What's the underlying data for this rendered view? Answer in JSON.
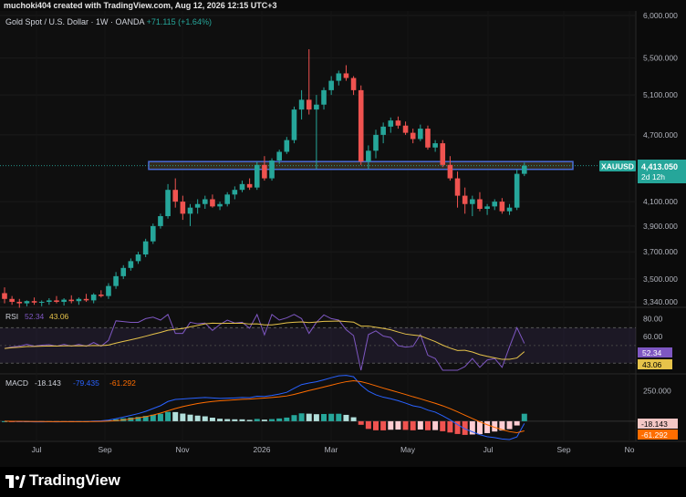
{
  "header": {
    "created_by": "muchoki404 created with TradingView.com, Aug 12, 2026 12:15 UTC+3"
  },
  "legend": {
    "symbol": "Gold Spot / U.S. Dollar · 1W · OANDA",
    "change": "+71.115 (+1.64%)"
  },
  "price_badge": {
    "ticker": "XAUUSD",
    "price": "4,413.050",
    "countdown": "2d 12h"
  },
  "rsi_legend": {
    "label": "RSI",
    "rsi": "52.34",
    "ma": "43.06"
  },
  "macd_legend": {
    "label": "MACD",
    "macd": "-18.143",
    "signal": "-79.435",
    "hist": "-61.292"
  },
  "footer": {
    "brand": "TradingView"
  },
  "colors": {
    "up": "#26a69a",
    "down": "#ef5350",
    "rsi": "#7e57c2",
    "rsi_ma": "#e6c34a",
    "macd": "#2962ff",
    "signal": "#ff6d00",
    "zone": "#4a6bd6"
  },
  "chart_data": [
    {
      "type": "candlestick",
      "title": "Gold Spot / U.S. Dollar · 1W · OANDA",
      "x_tick_labels": [
        "Jul",
        "Sep",
        "Nov",
        "2026",
        "Mar",
        "May",
        "Jul",
        "Sep",
        "No"
      ],
      "y_tick_labels": [
        "6,000.000",
        "5,500.000",
        "5,100.000",
        "4,700.000",
        "4,100.000",
        "3,900.000",
        "3,700.000",
        "3,500.000",
        "3,340.000"
      ],
      "y_scale": "log",
      "ylim": [
        3340,
        6000
      ],
      "last_price": 4413.05,
      "zone": [
        4380,
        4450
      ],
      "candles": [
        [
          3400,
          3440,
          3330,
          3360
        ],
        [
          3360,
          3380,
          3320,
          3340
        ],
        [
          3340,
          3360,
          3300,
          3330
        ],
        [
          3330,
          3350,
          3310,
          3345
        ],
        [
          3345,
          3370,
          3320,
          3335
        ],
        [
          3335,
          3350,
          3310,
          3340
        ],
        [
          3340,
          3365,
          3320,
          3350
        ],
        [
          3350,
          3380,
          3330,
          3340
        ],
        [
          3340,
          3365,
          3315,
          3355
        ],
        [
          3355,
          3385,
          3330,
          3345
        ],
        [
          3345,
          3370,
          3320,
          3360
        ],
        [
          3360,
          3395,
          3340,
          3350
        ],
        [
          3350,
          3400,
          3330,
          3390
        ],
        [
          3390,
          3420,
          3370,
          3380
        ],
        [
          3380,
          3470,
          3360,
          3450
        ],
        [
          3450,
          3550,
          3430,
          3520
        ],
        [
          3520,
          3600,
          3500,
          3580
        ],
        [
          3580,
          3650,
          3560,
          3630
        ],
        [
          3630,
          3700,
          3610,
          3680
        ],
        [
          3680,
          3800,
          3660,
          3780
        ],
        [
          3780,
          3920,
          3760,
          3900
        ],
        [
          3900,
          4000,
          3880,
          3980
        ],
        [
          3980,
          4250,
          3960,
          4200
        ],
        [
          4200,
          4300,
          4050,
          4100
        ],
        [
          4100,
          4150,
          3950,
          4000
        ],
        [
          4000,
          4080,
          3900,
          4050
        ],
        [
          4050,
          4120,
          4000,
          4080
        ],
        [
          4080,
          4150,
          4040,
          4120
        ],
        [
          4120,
          4160,
          4050,
          4060
        ],
        [
          4060,
          4100,
          4030,
          4080
        ],
        [
          4080,
          4180,
          4060,
          4160
        ],
        [
          4160,
          4230,
          4120,
          4200
        ],
        [
          4200,
          4280,
          4180,
          4250
        ],
        [
          4250,
          4300,
          4200,
          4220
        ],
        [
          4220,
          4450,
          4200,
          4420
        ],
        [
          4420,
          4500,
          4280,
          4300
        ],
        [
          4300,
          4480,
          4280,
          4460
        ],
        [
          4460,
          4560,
          4430,
          4540
        ],
        [
          4540,
          4680,
          4520,
          4650
        ],
        [
          4650,
          4980,
          4620,
          4950
        ],
        [
          4950,
          5150,
          4850,
          5050
        ],
        [
          5050,
          5600,
          4900,
          4950
        ],
        [
          4950,
          5100,
          4380,
          5000
        ],
        [
          5000,
          5180,
          4950,
          5150
        ],
        [
          5150,
          5300,
          5100,
          5250
        ],
        [
          5250,
          5360,
          5200,
          5330
        ],
        [
          5330,
          5420,
          5250,
          5280
        ],
        [
          5280,
          5300,
          5100,
          5150
        ],
        [
          5150,
          5200,
          4420,
          4450
        ],
        [
          4450,
          4600,
          4380,
          4550
        ],
        [
          4550,
          4750,
          4480,
          4700
        ],
        [
          4700,
          4820,
          4620,
          4780
        ],
        [
          4780,
          4870,
          4720,
          4840
        ],
        [
          4840,
          4880,
          4760,
          4790
        ],
        [
          4790,
          4830,
          4700,
          4720
        ],
        [
          4720,
          4760,
          4620,
          4660
        ],
        [
          4660,
          4800,
          4640,
          4760
        ],
        [
          4760,
          4790,
          4560,
          4580
        ],
        [
          4580,
          4650,
          4540,
          4620
        ],
        [
          4620,
          4650,
          4400,
          4420
        ],
        [
          4420,
          4500,
          4280,
          4300
        ],
        [
          4300,
          4360,
          4050,
          4150
        ],
        [
          4150,
          4220,
          4000,
          4080
        ],
        [
          4080,
          4150,
          3980,
          4120
        ],
        [
          4120,
          4180,
          4020,
          4040
        ],
        [
          4040,
          4080,
          3990,
          4060
        ],
        [
          4060,
          4120,
          4030,
          4100
        ],
        [
          4100,
          4130,
          4000,
          4020
        ],
        [
          4020,
          4080,
          3990,
          4050
        ],
        [
          4050,
          4380,
          4030,
          4340
        ],
        [
          4340,
          4440,
          4320,
          4413
        ]
      ]
    },
    {
      "type": "line",
      "name": "RSI",
      "y_tick_labels": [
        "80.00",
        "60.00"
      ],
      "ylim": [
        20,
        90
      ],
      "rsi_value": 52.34,
      "ma_value": 43.06
    },
    {
      "type": "line",
      "name": "MACD",
      "y_tick_labels": [
        "250.000"
      ],
      "macd_value": -18.143,
      "signal_value": -79.435,
      "hist_value": -61.292
    }
  ]
}
